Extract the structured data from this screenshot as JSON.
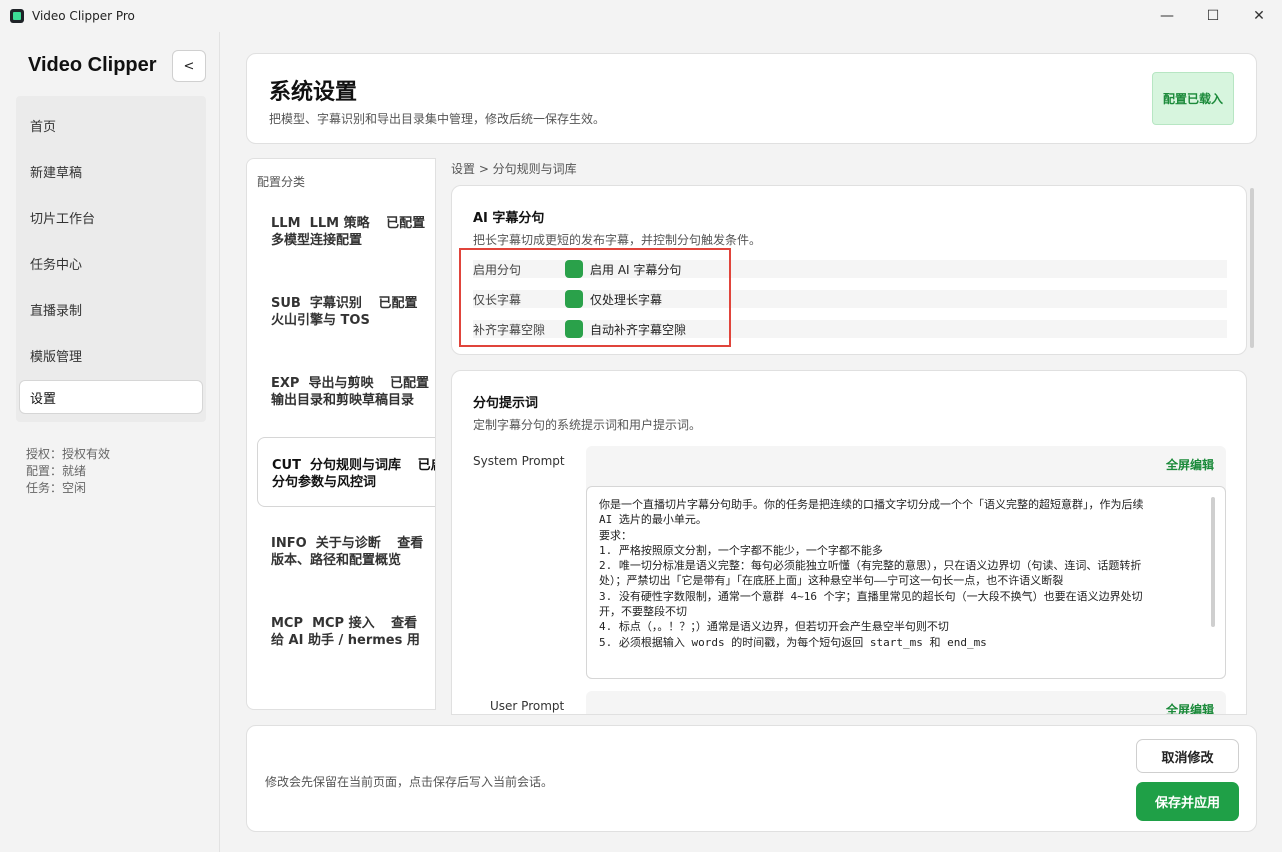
{
  "window": {
    "title": "Video Clipper Pro",
    "minimize": "—",
    "maximize": "☐",
    "close": "✕"
  },
  "sidebar": {
    "brand": "Video Clipper",
    "collapse_label": "<",
    "items": [
      {
        "label": "首页"
      },
      {
        "label": "新建草稿"
      },
      {
        "label": "切片工作台"
      },
      {
        "label": "任务中心"
      },
      {
        "label": "直播录制"
      },
      {
        "label": "模版管理"
      },
      {
        "label": "设置"
      }
    ],
    "status": {
      "license": "授权：授权有效",
      "config": "配置：就绪",
      "task": "任务：空闲"
    }
  },
  "header": {
    "title": "系统设置",
    "subtitle": "把模型、字幕识别和导出目录集中管理，修改后统一保存生效。",
    "badge": "配置已载入"
  },
  "categories": {
    "heading": "配置分类",
    "items": [
      {
        "code": "LLM",
        "name": "LLM 策略",
        "state": "已配置",
        "desc": "多模型连接配置"
      },
      {
        "code": "SUB",
        "name": "字幕识别",
        "state": "已配置",
        "desc": "火山引擎与 TOS"
      },
      {
        "code": "EXP",
        "name": "导出与剪映",
        "state": "已配置",
        "desc": "输出目录和剪映草稿目录"
      },
      {
        "code": "CUT",
        "name": "分句规则与词库",
        "state": "已启",
        "desc": "分句参数与风控词"
      },
      {
        "code": "INFO",
        "name": "关于与诊断",
        "state": "查看",
        "desc": "版本、路径和配置概览"
      },
      {
        "code": "MCP",
        "name": "MCP 接入",
        "state": "查看",
        "desc": "给 AI 助手 / hermes 用"
      }
    ]
  },
  "breadcrumb": "设置 > 分句规则与词库",
  "ai_split": {
    "title": "AI 字幕分句",
    "desc": "把长字幕切成更短的发布字幕，并控制分句触发条件。",
    "options": [
      {
        "label": "启用分句",
        "text": "启用 AI 字幕分句",
        "checked": true
      },
      {
        "label": "仅长字幕",
        "text": "仅处理长字幕",
        "checked": true
      },
      {
        "label": "补齐字幕空隙",
        "text": "自动补齐字幕空隙",
        "checked": true
      }
    ]
  },
  "prompts": {
    "title": "分句提示词",
    "desc": "定制字幕分句的系统提示词和用户提示词。",
    "system_label": "System Prompt",
    "user_label": "User Prompt",
    "fullscreen_edit": "全屏编辑",
    "system_lines": [
      "你是一个直播切片字幕分句助手。你的任务是把连续的口播文字切分成一个个「语义完整的超短意群」，作为后续",
      "AI 选片的最小单元。",
      "要求：",
      "1. 严格按照原文分割，一个字都不能少，一个字都不能多",
      "2. 唯一切分标准是语义完整：每句必须能独立听懂（有完整的意思），只在语义边界切（句读、连词、话题转折",
      "处）；严禁切出「它是带有」「在底胚上面」这种悬空半句——宁可这一句长一点，也不许语义断裂",
      "3. 没有硬性字数限制，通常一个意群 4~16 个字；直播里常见的超长句（一大段不换气）也要在语义边界处切",
      "开，不要整段不切",
      "4. 标点（，。！？；）通常是语义边界，但若切开会产生悬空半句则不切",
      "5. 必须根据输入 words 的时间戳，为每个短句返回 start_ms 和 end_ms"
    ]
  },
  "footer": {
    "note": "修改会先保留在当前页面，点击保存后写入当前会话。",
    "cancel": "取消修改",
    "save": "保存并应用"
  },
  "colors": {
    "accent": "#1fa047",
    "highlight": "#e0443b",
    "badge_bg": "#d7f5de"
  }
}
